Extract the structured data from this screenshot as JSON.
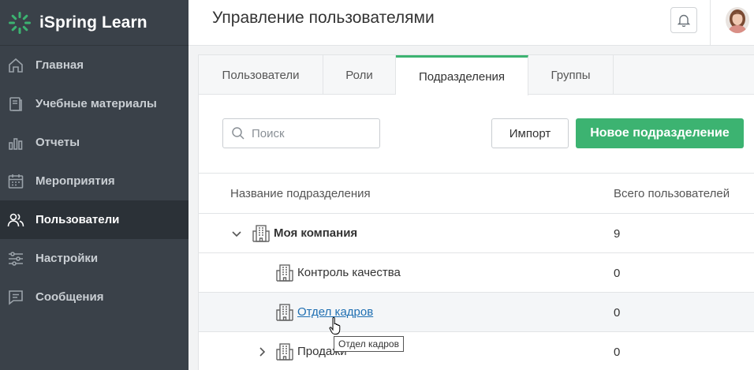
{
  "brand": {
    "name": "iSpring Learn",
    "accent": "#3cb371"
  },
  "sidebar": {
    "items": [
      {
        "label": "Главная",
        "icon": "home-icon"
      },
      {
        "label": "Учебные материалы",
        "icon": "book-icon"
      },
      {
        "label": "Отчеты",
        "icon": "bar-chart-icon"
      },
      {
        "label": "Мероприятия",
        "icon": "calendar-icon"
      },
      {
        "label": "Пользователи",
        "icon": "users-icon",
        "active": true
      },
      {
        "label": "Настройки",
        "icon": "sliders-icon"
      },
      {
        "label": "Сообщения",
        "icon": "message-icon"
      }
    ]
  },
  "header": {
    "title": "Управление пользователями"
  },
  "tabs": [
    {
      "label": "Пользователи"
    },
    {
      "label": "Роли"
    },
    {
      "label": "Подразделения",
      "active": true
    },
    {
      "label": "Группы"
    }
  ],
  "toolbar": {
    "search_placeholder": "Поиск",
    "import_label": "Импорт",
    "new_label": "Новое подразделение"
  },
  "table": {
    "headers": {
      "name": "Название подразделения",
      "count": "Всего пользователей"
    },
    "rows": [
      {
        "name": "Моя компания",
        "count": "9",
        "expanded": true
      },
      {
        "name": "Контроль качества",
        "count": "0"
      },
      {
        "name": "Отдел кадров",
        "count": "0",
        "hovered": true
      },
      {
        "name": "Продажи",
        "count": "0",
        "expanded": false
      }
    ]
  },
  "tooltip": {
    "text": "Отдел кадров"
  }
}
